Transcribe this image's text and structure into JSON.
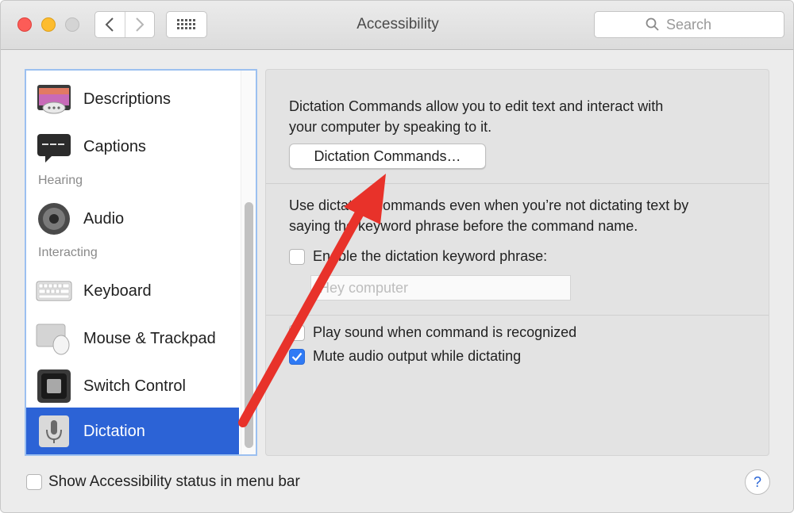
{
  "window": {
    "title": "Accessibility"
  },
  "toolbar": {
    "search_placeholder": "Search"
  },
  "sidebar": {
    "items": [
      {
        "label": "Descriptions",
        "icon": "descriptions-icon"
      },
      {
        "label": "Captions",
        "icon": "captions-icon"
      },
      {
        "label": "Audio",
        "icon": "speaker-icon"
      },
      {
        "label": "Keyboard",
        "icon": "keyboard-icon"
      },
      {
        "label": "Mouse & Trackpad",
        "icon": "mouse-icon"
      },
      {
        "label": "Switch Control",
        "icon": "switch-control-icon"
      },
      {
        "label": "Dictation",
        "icon": "microphone-icon",
        "selected": true
      }
    ],
    "headers": {
      "hearing": "Hearing",
      "interacting": "Interacting"
    }
  },
  "pane": {
    "intro_line1": "Dictation Commands allow you to edit text and interact with",
    "intro_line2": "your computer by speaking to it.",
    "dictation_button": "Dictation Commands…",
    "desc_line1": "Use dictation commands even when you’re not dictating text by",
    "desc_line2": "saying the keyword phrase before the command name.",
    "enable_keyword_label": "Enable the dictation keyword phrase:",
    "enable_keyword_checked": false,
    "keyword_placeholder": "Hey computer",
    "play_sound_label": "Play sound when command is recognized",
    "play_sound_checked": false,
    "mute_audio_label": "Mute audio output while dictating",
    "mute_audio_checked": true
  },
  "bottom": {
    "show_status_label": "Show Accessibility status in menu bar",
    "show_status_checked": false,
    "help_label": "?"
  },
  "colors": {
    "selection": "#2c63d6",
    "checkbox_checked": "#2f7af5",
    "annotation_arrow": "#e8322a"
  }
}
